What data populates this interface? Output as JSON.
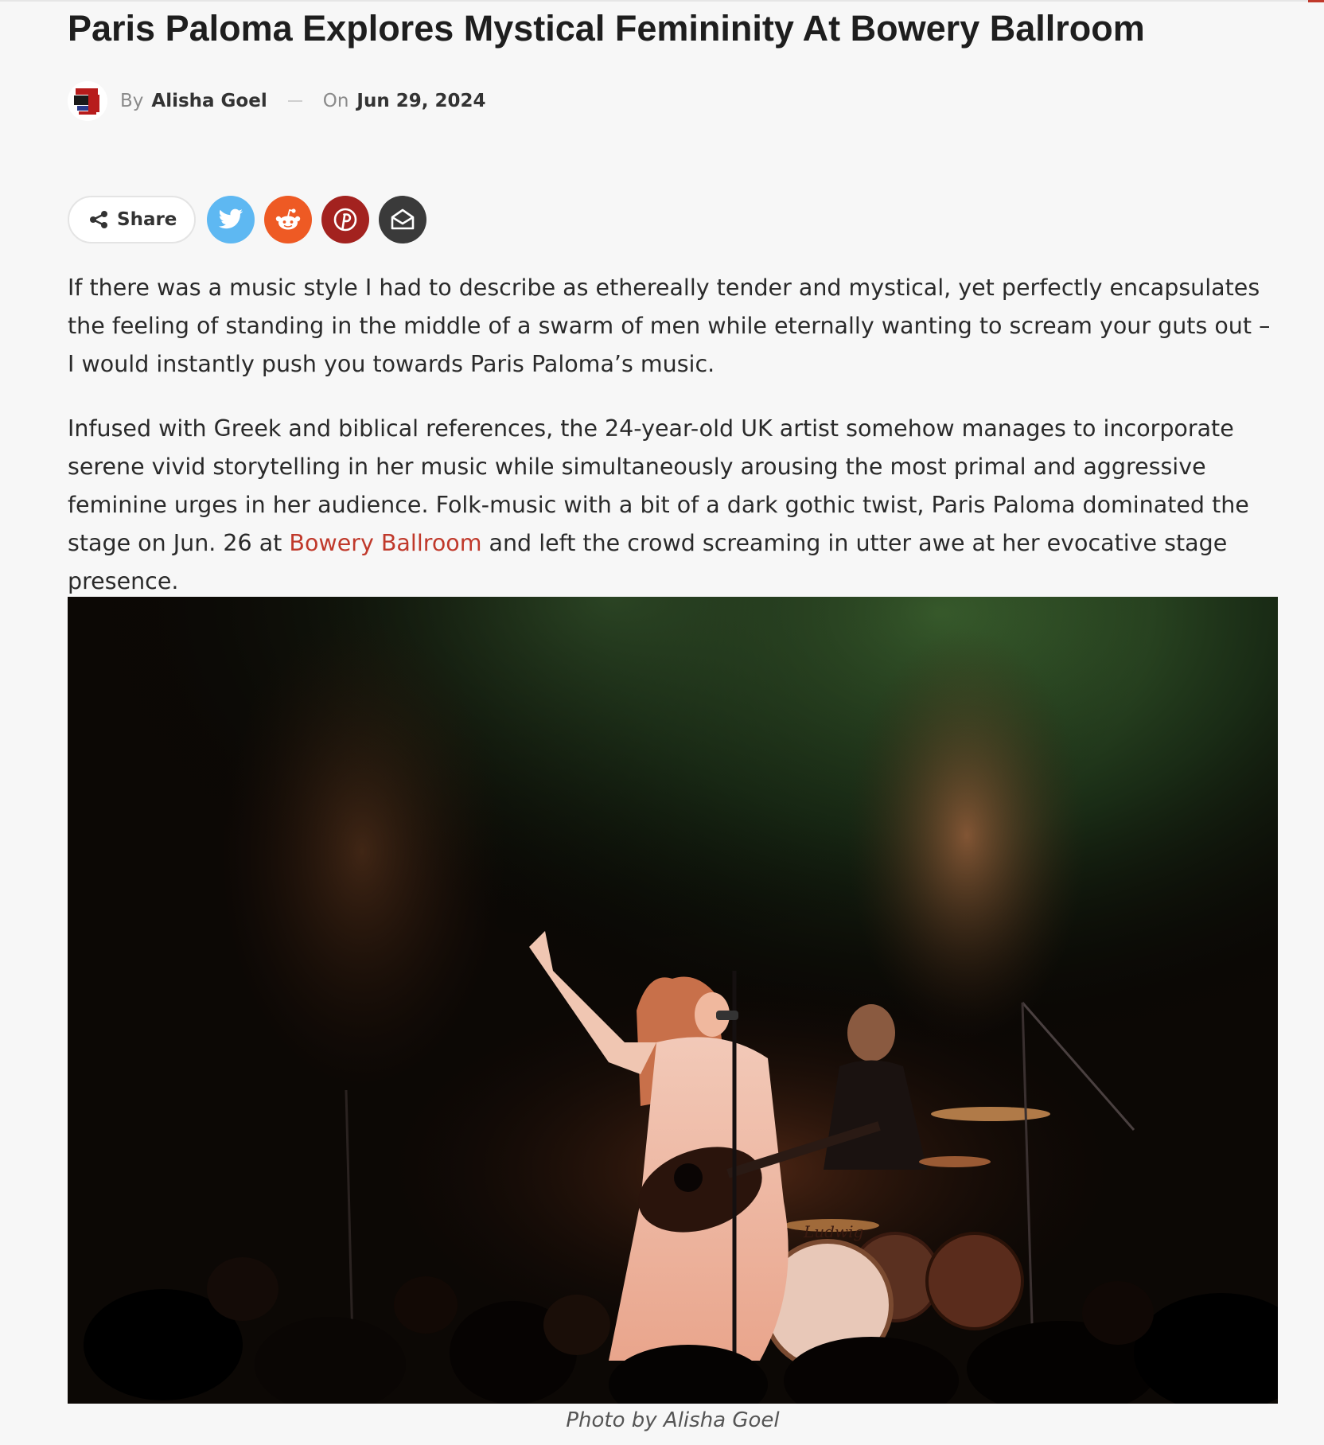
{
  "article": {
    "title": "Paris Paloma Explores Mystical Femininity At Bowery Ballroom",
    "meta": {
      "by_label": "By",
      "author": "Alisha Goel",
      "on_label": "On",
      "date": "Jun 29, 2024",
      "avatar_icon": "author-avatar-logo"
    },
    "share": {
      "label": "Share",
      "buttons": [
        {
          "name": "twitter",
          "icon": "twitter-bird-icon",
          "color": "#5eb8f2"
        },
        {
          "name": "reddit",
          "icon": "reddit-alien-icon",
          "color": "#ee5a24"
        },
        {
          "name": "pinterest",
          "icon": "pinterest-p-icon",
          "color": "#a3221f"
        },
        {
          "name": "email",
          "icon": "envelope-open-icon",
          "color": "#3a3a3a"
        }
      ]
    },
    "paragraphs": {
      "p1": "If there was a music style I had to describe as ethereally tender and mystical, yet perfectly encapsulates the feeling of standing in the middle of a swarm of men while eternally wanting to scream your guts out – I would instantly push you towards Paris Paloma’s music.",
      "p2_before_link": "Infused with Greek and biblical references, the 24-year-old UK artist somehow manages to incorporate serene vivid storytelling in her music while simultaneously arousing the most primal and aggressive feminine urges in her audience. Folk-music with a bit of a dark gothic twist, Paris Paloma dominated the stage on Jun. 26 at ",
      "p2_link": "Bowery Ballroom",
      "p2_after_link": " and left the crowd screaming in utter awe at her evocative stage presence."
    },
    "photo": {
      "caption": "Photo by Alisha Goel",
      "drum_brand": "Ludwig"
    }
  },
  "theme": {
    "accent": "#c0392b",
    "background": "#f7f7f7"
  }
}
